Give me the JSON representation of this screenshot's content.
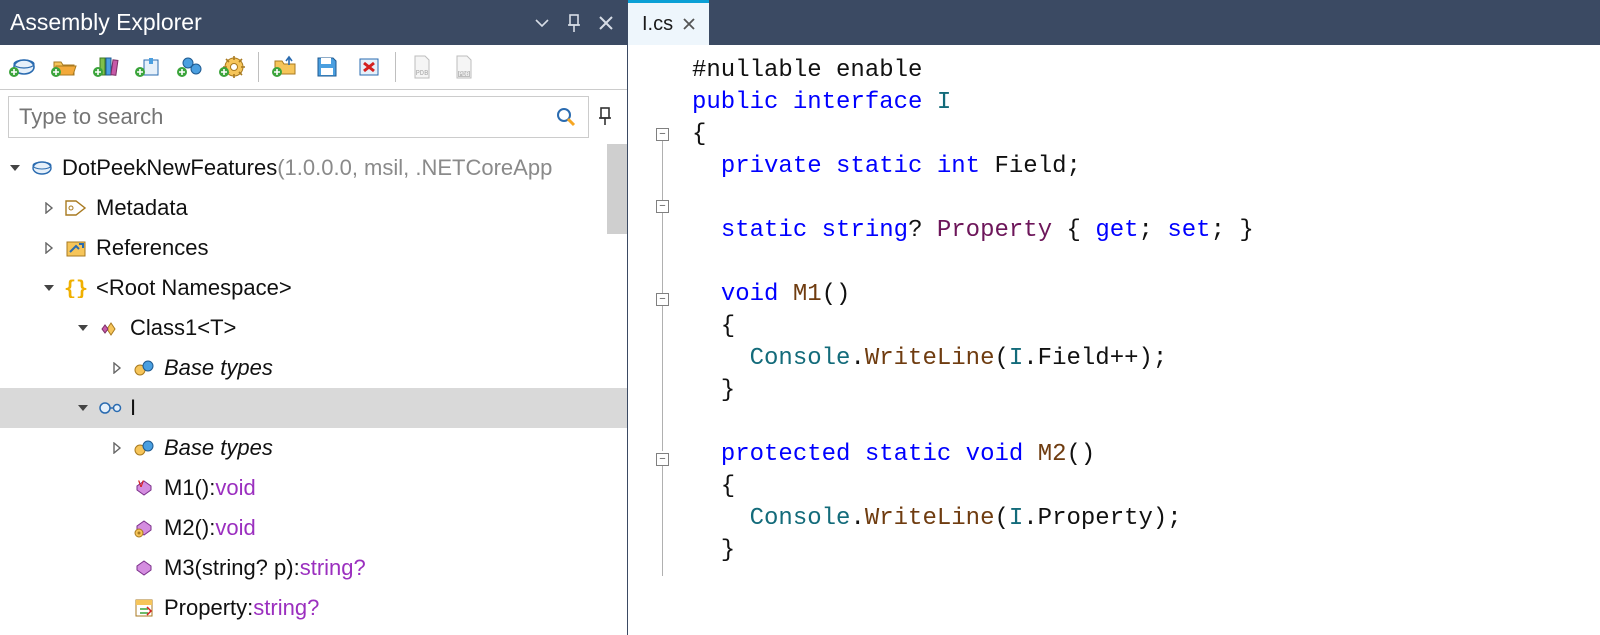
{
  "panel": {
    "title": "Assembly Explorer",
    "search_placeholder": "Type to search"
  },
  "tree": {
    "root_name": "DotPeekNewFeatures",
    "root_suffix": " (1.0.0.0, msil, .NETCoreApp",
    "metadata": "Metadata",
    "references": "References",
    "root_ns": "<Root Namespace>",
    "class1": "Class1<T>",
    "base_types": "Base types",
    "interface_i": "I",
    "m1_name": "M1():",
    "m1_ret": "void",
    "m2_name": "M2():",
    "m2_ret": "void",
    "m3_name": "M3(string? p):",
    "m3_ret": "string?",
    "prop_name": "Property:",
    "prop_ret": "string?"
  },
  "tab": {
    "filename": "I.cs"
  },
  "code_tokens": {
    "t00_a": "#nullable enable",
    "t01_a": "public",
    "t01_b": " ",
    "t01_c": "interface",
    "t01_d": " ",
    "t01_e": "I",
    "t02_a": "{",
    "t03_a": "  ",
    "t03_b": "private",
    "t03_c": " ",
    "t03_d": "static",
    "t03_e": " ",
    "t03_f": "int",
    "t03_g": " Field;",
    "t04_a": "",
    "t05_a": "  ",
    "t05_b": "static",
    "t05_c": " ",
    "t05_d": "string",
    "t05_e": "? ",
    "t05_f": "Property",
    "t05_g": " { ",
    "t05_h": "get",
    "t05_i": "; ",
    "t05_j": "set",
    "t05_k": "; }",
    "t06_a": "",
    "t07_a": "  ",
    "t07_b": "void",
    "t07_c": " ",
    "t07_d": "M1",
    "t07_e": "()",
    "t08_a": "  {",
    "t09_a": "    ",
    "t09_b": "Console",
    "t09_c": ".",
    "t09_d": "WriteLine",
    "t09_e": "(",
    "t09_f": "I",
    "t09_g": ".Field++);",
    "t10_a": "  }",
    "t11_a": "",
    "t12_a": "  ",
    "t12_b": "protected",
    "t12_c": " ",
    "t12_d": "static",
    "t12_e": " ",
    "t12_f": "void",
    "t12_g": " ",
    "t12_h": "M2",
    "t12_i": "()",
    "t13_a": "  {",
    "t14_a": "    ",
    "t14_b": "Console",
    "t14_c": ".",
    "t14_d": "WriteLine",
    "t14_e": "(",
    "t14_f": "I",
    "t14_g": ".Property);",
    "t15_a": "  }"
  }
}
